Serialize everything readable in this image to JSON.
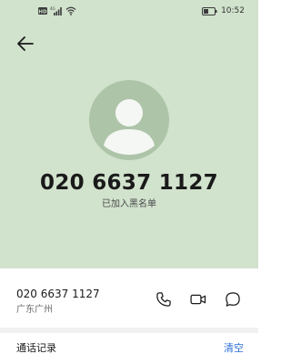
{
  "status_bar": {
    "time": "10:52",
    "network_label": "4G"
  },
  "contact": {
    "phone_number": "020 6637 1127",
    "blocked_text": "已加入黑名单",
    "location": "广东广州"
  },
  "history": {
    "title": "通话记录",
    "clear_label": "清空"
  },
  "colors": {
    "header_background": "#d1e2cd",
    "avatar_circle": "#adc4a8",
    "link_blue": "#2f6fd6"
  },
  "icons": [
    "hd-icon",
    "signal-icon",
    "wifi-icon",
    "battery-icon",
    "back-arrow-icon",
    "avatar-icon",
    "phone-icon",
    "video-call-icon",
    "message-icon"
  ]
}
